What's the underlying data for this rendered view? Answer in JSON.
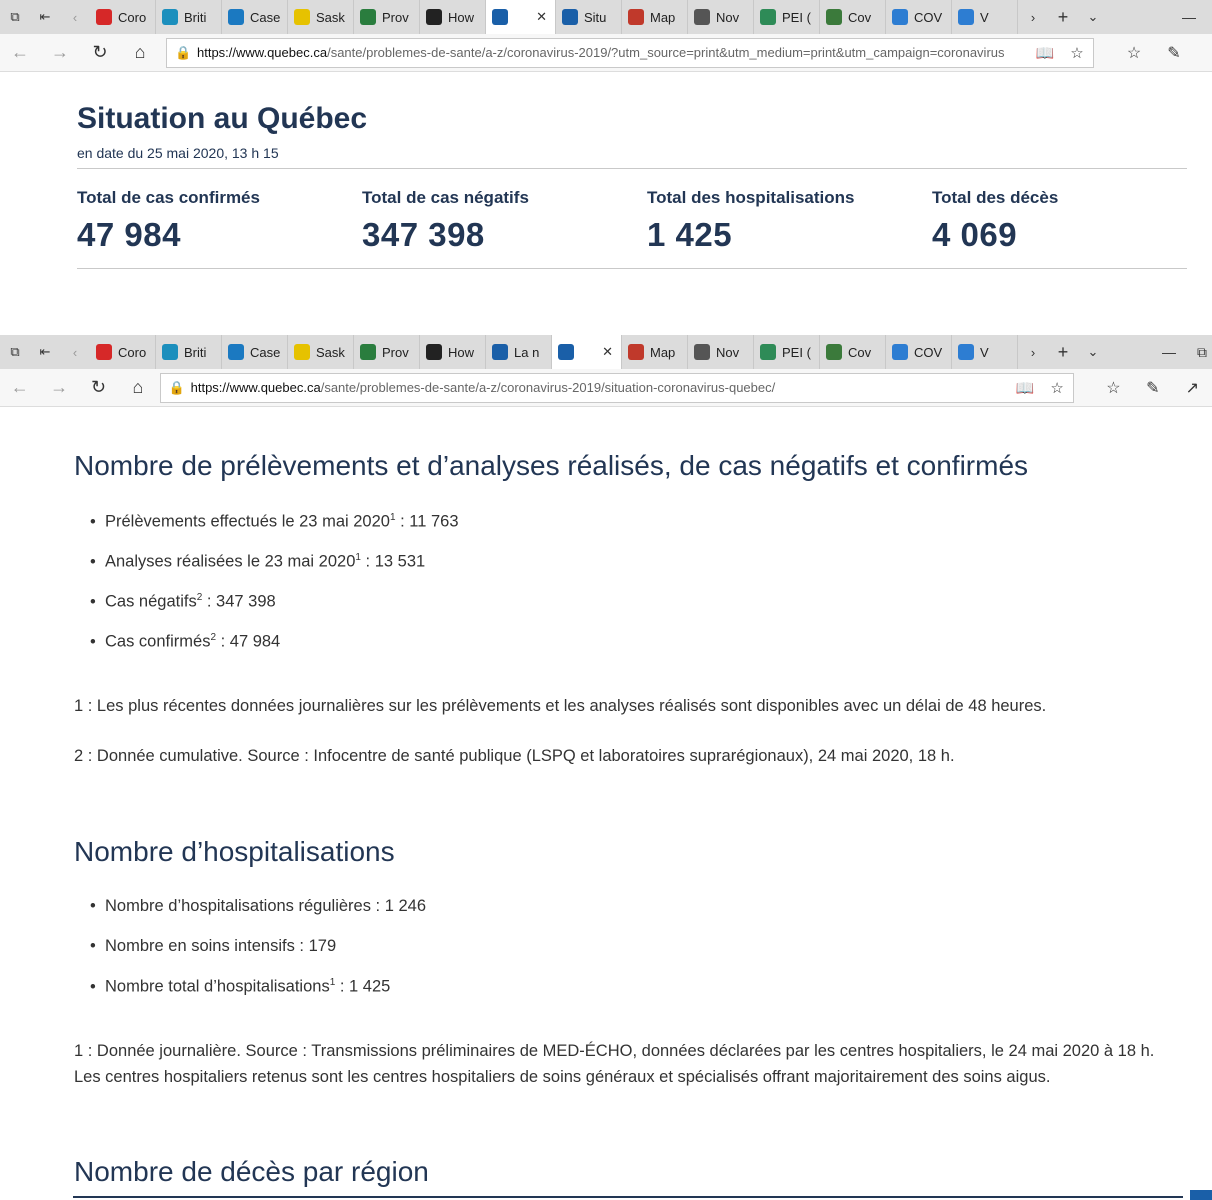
{
  "window1": {
    "tabs": [
      {
        "label": "Coro",
        "icon": "maple-leaf-icon",
        "color": "#d62828"
      },
      {
        "label": "Briti",
        "icon": "bc-icon",
        "color": "#1c8fbd"
      },
      {
        "label": "Case",
        "icon": "alberta-icon",
        "color": "#1b79c1"
      },
      {
        "label": "Sask",
        "icon": "sask-icon",
        "color": "#e6c200"
      },
      {
        "label": "Prov",
        "icon": "manitoba-icon",
        "color": "#2a7d3e"
      },
      {
        "label": "How",
        "icon": "ontario-icon",
        "color": "#222222"
      },
      {
        "label": "",
        "icon": "quebec-icon",
        "color": "#1a5fa8",
        "active": true
      },
      {
        "label": "Situ",
        "icon": "quebec-icon",
        "color": "#1a5fa8"
      },
      {
        "label": "Map",
        "icon": "nb-icon",
        "color": "#c0392b"
      },
      {
        "label": "Nov",
        "icon": "ns-icon",
        "color": "#555555"
      },
      {
        "label": "PEI (",
        "icon": "pei-icon",
        "color": "#2e8b57"
      },
      {
        "label": "Cov",
        "icon": "nl-icon",
        "color": "#3b7a3b"
      },
      {
        "label": "COV",
        "icon": "yukon-icon",
        "color": "#2d7dd2"
      },
      {
        "label": "V",
        "icon": "nwt-icon",
        "color": "#2d7dd2"
      }
    ],
    "url_domain": "https://www.quebec.ca",
    "url_path": "/sante/problemes-de-sante/a-z/coronavirus-2019/?utm_source=print&utm_medium=print&utm_campaign=coronavirus"
  },
  "situation": {
    "title": "Situation au Québec",
    "date": "en date du 25 mai 2020, 13 h 15",
    "stats": [
      {
        "label": "Total de cas confirmés",
        "value": "47 984"
      },
      {
        "label": "Total de cas négatifs",
        "value": "347 398"
      },
      {
        "label": "Total des hospitalisations",
        "value": "1 425"
      },
      {
        "label": "Total des décès",
        "value": "4 069"
      }
    ]
  },
  "window2": {
    "tabs": [
      {
        "label": "Coro",
        "icon": "maple-leaf-icon",
        "color": "#d62828"
      },
      {
        "label": "Briti",
        "icon": "bc-icon",
        "color": "#1c8fbd"
      },
      {
        "label": "Case",
        "icon": "alberta-icon",
        "color": "#1b79c1"
      },
      {
        "label": "Sask",
        "icon": "sask-icon",
        "color": "#e6c200"
      },
      {
        "label": "Prov",
        "icon": "manitoba-icon",
        "color": "#2a7d3e"
      },
      {
        "label": "How",
        "icon": "ontario-icon",
        "color": "#222222"
      },
      {
        "label": "La n",
        "icon": "quebec-icon",
        "color": "#1a5fa8"
      },
      {
        "label": "",
        "icon": "quebec-icon",
        "color": "#1a5fa8",
        "active": true
      },
      {
        "label": "Map",
        "icon": "nb-icon",
        "color": "#c0392b"
      },
      {
        "label": "Nov",
        "icon": "ns-icon",
        "color": "#555555"
      },
      {
        "label": "PEI (",
        "icon": "pei-icon",
        "color": "#2e8b57"
      },
      {
        "label": "Cov",
        "icon": "nl-icon",
        "color": "#3b7a3b"
      },
      {
        "label": "COV",
        "icon": "yukon-icon",
        "color": "#2d7dd2"
      },
      {
        "label": "V",
        "icon": "nwt-icon",
        "color": "#2d7dd2"
      }
    ],
    "url_domain": "https://www.quebec.ca",
    "url_path": "/sante/problemes-de-sante/a-z/coronavirus-2019/situation-coronavirus-quebec/"
  },
  "tests": {
    "heading": "Nombre de prélèvements et d’analyses réalisés, de cas négatifs et confirmés",
    "items": [
      {
        "text": "Prélèvements effectués le 23 mai 2020",
        "sup": "1",
        "value": " : 11 763"
      },
      {
        "text": "Analyses réalisées le 23 mai 2020",
        "sup": "1",
        "value": " : 13 531"
      },
      {
        "text": "Cas négatifs",
        "sup": "2",
        "value": " : 347 398"
      },
      {
        "text": "Cas confirmés",
        "sup": "2",
        "value": " : 47 984"
      }
    ],
    "note1": "1 : Les plus récentes données journalières sur les prélèvements et les analyses réalisés sont disponibles avec un délai de 48 heures.",
    "note2": "2 : Donnée cumulative. Source : Infocentre de santé publique (LSPQ et laboratoires suprarégionaux), 24 mai 2020, 18 h."
  },
  "hosp": {
    "heading": "Nombre d’hospitalisations",
    "items": [
      {
        "text": "Nombre d’hospitalisations régulières : 1 246",
        "sup": "",
        "value": ""
      },
      {
        "text": "Nombre en soins intensifs : 179",
        "sup": "",
        "value": ""
      },
      {
        "text": "Nombre total d’hospitalisations",
        "sup": "1",
        "value": " : 1 425"
      }
    ],
    "note1": "1 : Donnée journalière. Source : Transmissions préliminaires de MED-ÉCHO, données déclarées par les centres hospitaliers, le 24 mai 2020 à 18 h. Les centres hospitaliers retenus sont les centres hospitaliers de soins généraux et spécialisés offrant majoritairement des soins aigus."
  },
  "deaths": {
    "heading": "Nombre de décès par région"
  }
}
